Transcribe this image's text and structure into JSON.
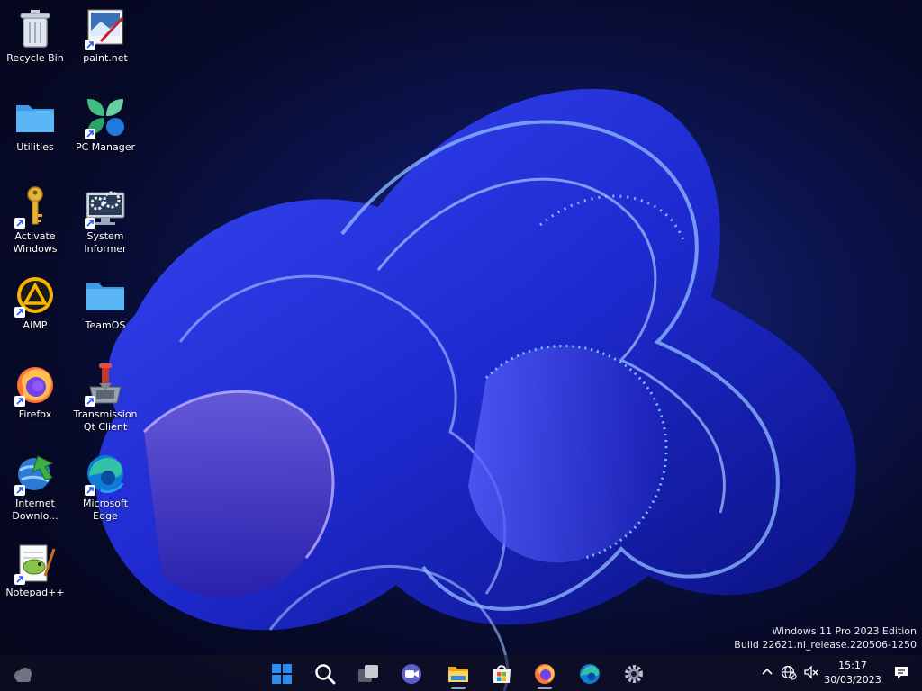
{
  "desktop": {
    "icons": [
      {
        "label": "Recycle Bin",
        "icon": "recycle-bin-icon",
        "shortcut": false
      },
      {
        "label": "paint.net",
        "icon": "paint-net-icon",
        "shortcut": true
      },
      {
        "label": "Utilities",
        "icon": "folder-icon",
        "shortcut": false
      },
      {
        "label": "PC Manager",
        "icon": "pc-manager-icon",
        "shortcut": true
      },
      {
        "label": "Activate Windows",
        "icon": "key-icon",
        "shortcut": true
      },
      {
        "label": "System Informer",
        "icon": "system-informer-icon",
        "shortcut": true
      },
      {
        "label": "AIMP",
        "icon": "aimp-icon",
        "shortcut": true
      },
      {
        "label": "TeamOS",
        "icon": "folder-icon",
        "shortcut": false
      },
      {
        "label": "Firefox",
        "icon": "firefox-icon",
        "shortcut": true
      },
      {
        "label": "Transmission Qt Client",
        "icon": "transmission-icon",
        "shortcut": true
      },
      {
        "label": "Internet Downlo...",
        "icon": "internet-download-manager-icon",
        "shortcut": true
      },
      {
        "label": "Microsoft Edge",
        "icon": "edge-icon",
        "shortcut": true
      },
      {
        "label": "Notepad++",
        "icon": "notepad-plus-plus-icon",
        "shortcut": true
      }
    ]
  },
  "watermark": {
    "edition": "Windows 11 Pro 2023 Edition",
    "build": "Build 22621.ni_release.220506-1250"
  },
  "taskbar": {
    "apps": [
      {
        "name": "start",
        "icon": "windows-logo-icon"
      },
      {
        "name": "search",
        "icon": "search-icon"
      },
      {
        "name": "task-view",
        "icon": "task-view-icon"
      },
      {
        "name": "meet",
        "icon": "video-camera-icon"
      },
      {
        "name": "file-explorer",
        "icon": "file-explorer-icon"
      },
      {
        "name": "microsoft-store",
        "icon": "store-icon"
      },
      {
        "name": "firefox",
        "icon": "firefox-icon"
      },
      {
        "name": "edge",
        "icon": "edge-icon"
      },
      {
        "name": "settings",
        "icon": "gear-icon"
      }
    ],
    "tray": {
      "time": "15:17",
      "date": "30/03/2023"
    }
  },
  "colors": {
    "accent": "#1e56ff",
    "taskbar": "#121226"
  }
}
